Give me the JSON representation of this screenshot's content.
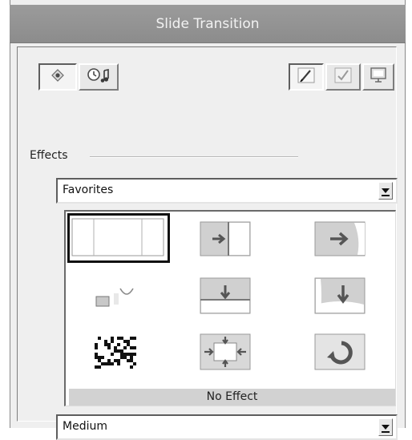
{
  "window": {
    "title": "Slide Transition"
  },
  "toolbar_left": [
    {
      "name": "effects-tab",
      "icon": "diamond-icon",
      "pressed": true
    },
    {
      "name": "timing-sound-tab",
      "icon": "clock-music-icon",
      "pressed": false
    }
  ],
  "toolbar_right": [
    {
      "name": "pencil-tool",
      "icon": "pencil-icon",
      "pressed": true
    },
    {
      "name": "check-tool",
      "icon": "checkmark-icon",
      "pressed": false
    },
    {
      "name": "preview-tool",
      "icon": "monitor-icon",
      "pressed": false
    }
  ],
  "effects": {
    "label": "Effects",
    "category_value": "Favorites",
    "selected_effect": "No Effect",
    "transitions": [
      {
        "id": "no-effect",
        "icon": "blank-slide-icon",
        "selected": true
      },
      {
        "id": "split-horizontal",
        "icon": "split-left-arrow-icon"
      },
      {
        "id": "wipe-right",
        "icon": "wipe-right-arrow-icon"
      },
      {
        "id": "box-shape",
        "icon": "box-circle-icon"
      },
      {
        "id": "split-vertical",
        "icon": "split-down-arrow-icon"
      },
      {
        "id": "wipe-down",
        "icon": "wipe-down-arrow-icon"
      },
      {
        "id": "dissolve",
        "icon": "checker-noise-icon"
      },
      {
        "id": "push-arrows",
        "icon": "four-arrows-icon"
      },
      {
        "id": "wheel",
        "icon": "circular-arrow-icon"
      }
    ]
  },
  "speed": {
    "value": "Medium"
  }
}
